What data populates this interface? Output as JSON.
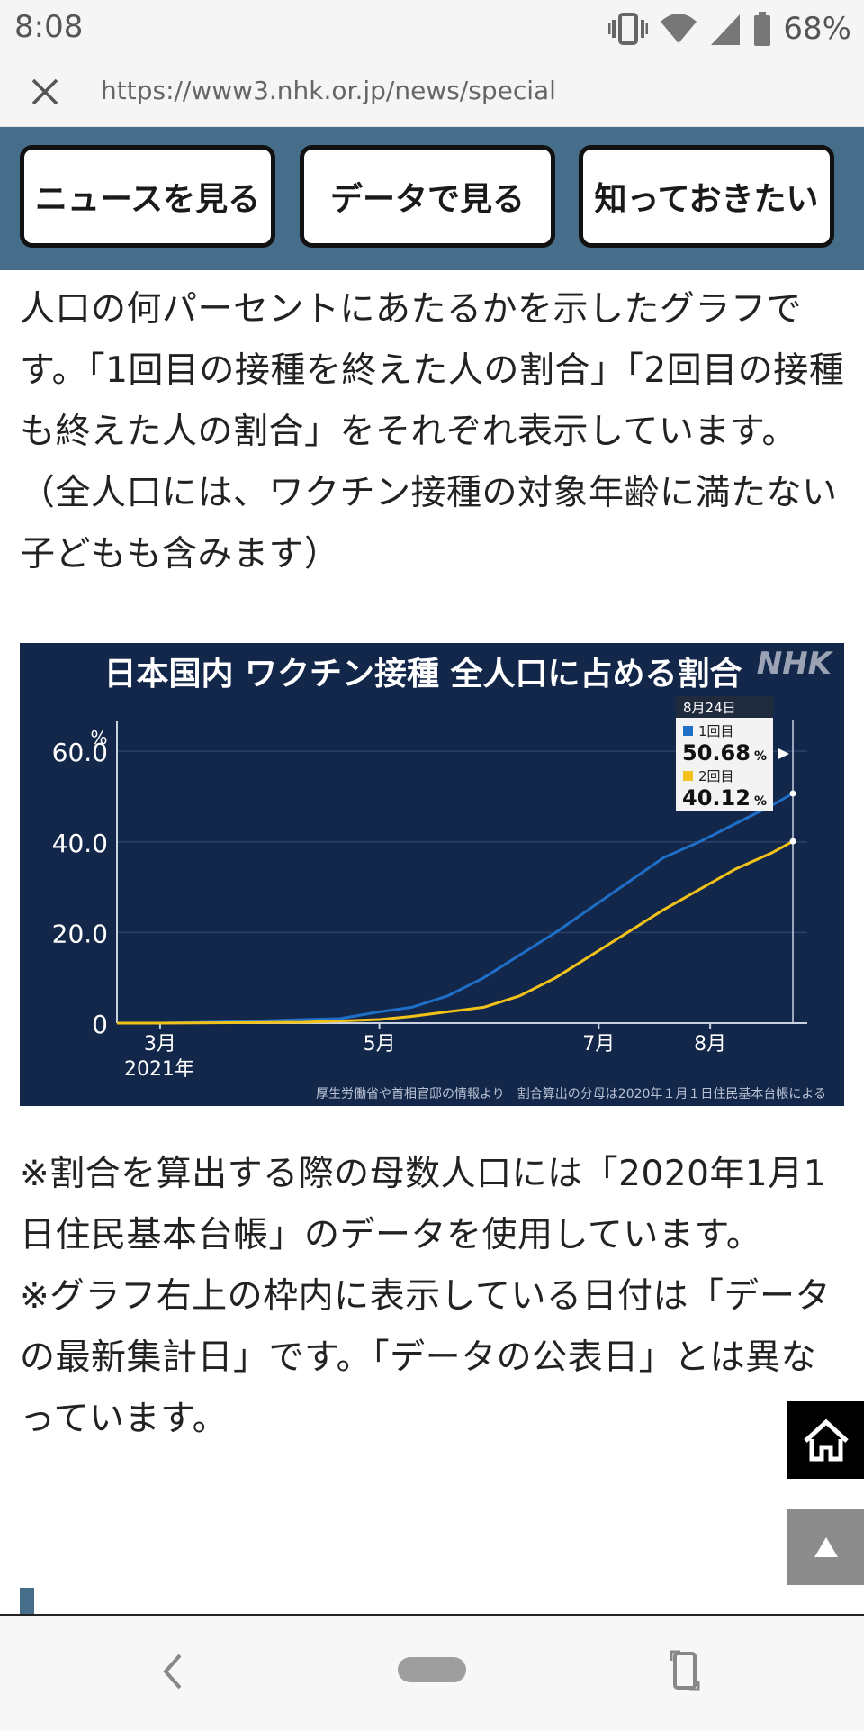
{
  "status": {
    "time": "8:08",
    "battery": "68%"
  },
  "browser": {
    "url": "https://www3.nhk.or.jp/news/special"
  },
  "nav": {
    "buttons": [
      "ニュースを見る",
      "データで見る",
      "知っておきたい"
    ]
  },
  "article": {
    "para1": "人口の何パーセントにあたるかを示したグラフです。「1回目の接種を終えた人の割合」「2回目の接種も終えた人の割合」をそれぞれ表示しています。（全人口には、ワクチン接種の対象年齢に満たない子どもも含みます）",
    "para2_line1": "※割合を算出する際の母数人口には「2020年1月1日住民基本台帳」のデータを使用しています。",
    "para2_line2": "※グラフ右上の枠内に表示している日付は「データの最新集計日」です。「データの公表日」とは異なっています。"
  },
  "chart_data": {
    "type": "line",
    "title": "日本国内 ワクチン接種 全人口に占める割合",
    "logo": "NHK",
    "ylabel": "%",
    "ylim": [
      0,
      65
    ],
    "yticks": [
      "0",
      "20.0",
      "40.0",
      "60.0"
    ],
    "yticks_values": [
      0,
      20,
      40,
      60
    ],
    "x_ticks": [
      {
        "label": "3月",
        "day": 60
      },
      {
        "label": "5月",
        "day": 121
      },
      {
        "label": "7月",
        "day": 182
      },
      {
        "label": "8月",
        "day": 213
      }
    ],
    "year_label": "2021年",
    "xlim_day": [
      48,
      240
    ],
    "source": "厚生労働省や首相官邸の情報より　割合算出の分母は2020年１月１日住民基本台帳による",
    "callout": {
      "date": "8月24日",
      "first_label": "1回目",
      "first_value": "50.68",
      "second_label": "2回目",
      "second_value": "40.12",
      "unit": "%"
    },
    "series": [
      {
        "name": "1回目",
        "color": "#1f6fc8",
        "points": [
          [
            48,
            0
          ],
          [
            60,
            0
          ],
          [
            80,
            0.3
          ],
          [
            100,
            0.8
          ],
          [
            110,
            1.0
          ],
          [
            121,
            2.5
          ],
          [
            130,
            3.5
          ],
          [
            140,
            6
          ],
          [
            150,
            10
          ],
          [
            160,
            15
          ],
          [
            170,
            20
          ],
          [
            180,
            25.5
          ],
          [
            190,
            31
          ],
          [
            200,
            36.5
          ],
          [
            210,
            40
          ],
          [
            220,
            44
          ],
          [
            230,
            48
          ],
          [
            236,
            50.68
          ]
        ]
      },
      {
        "name": "2回目",
        "color": "#f2c21b",
        "points": [
          [
            48,
            0
          ],
          [
            60,
            0
          ],
          [
            100,
            0.2
          ],
          [
            121,
            0.8
          ],
          [
            130,
            1.5
          ],
          [
            140,
            2.5
          ],
          [
            150,
            3.5
          ],
          [
            160,
            6
          ],
          [
            170,
            10
          ],
          [
            180,
            15
          ],
          [
            190,
            20
          ],
          [
            200,
            25
          ],
          [
            210,
            29.5
          ],
          [
            220,
            34
          ],
          [
            230,
            37.5
          ],
          [
            236,
            40.12
          ]
        ]
      }
    ]
  },
  "colors": {
    "nav_band": "#466e8b",
    "chart_bg": "#13274a",
    "series1": "#1f6fc8",
    "series2": "#f2c21b"
  },
  "icons": [
    "close-icon",
    "vibrate-icon",
    "wifi-icon",
    "signal-icon",
    "battery-icon",
    "home-icon",
    "triangle-up-icon",
    "back-icon",
    "rotate-icon"
  ]
}
